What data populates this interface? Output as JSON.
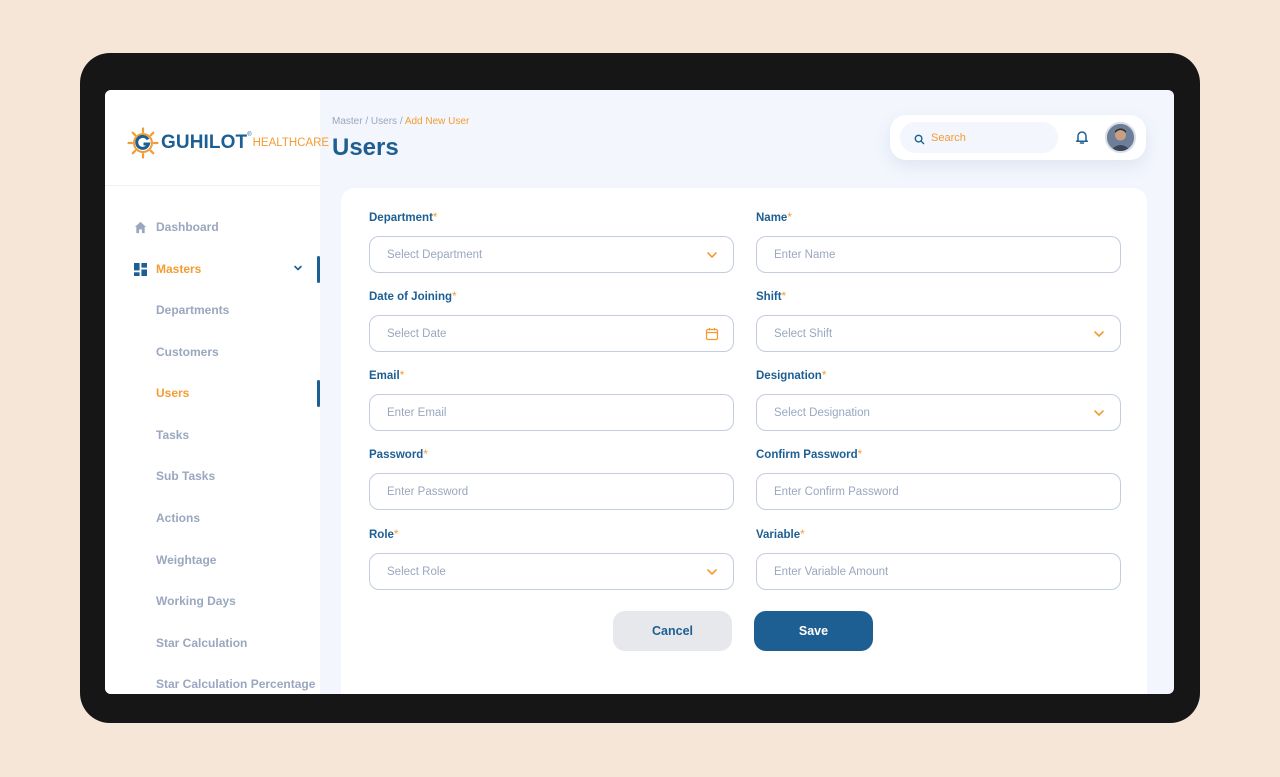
{
  "brand": {
    "name": "GUHILOT",
    "reg": "®",
    "sub": "HEALTHCARE",
    "primary": "#1d5f93",
    "accent": "#f39c33"
  },
  "sidebar": {
    "items": [
      {
        "label": "Dashboard",
        "icon": "home-icon",
        "active": false
      },
      {
        "label": "Masters",
        "icon": "grid-icon",
        "active": true,
        "expanded": true
      },
      {
        "label": "Departments"
      },
      {
        "label": "Customers"
      },
      {
        "label": "Users",
        "active": true
      },
      {
        "label": "Tasks"
      },
      {
        "label": "Sub Tasks"
      },
      {
        "label": "Actions"
      },
      {
        "label": "Weightage"
      },
      {
        "label": "Working Days"
      },
      {
        "label": "Star Calculation"
      },
      {
        "label": "Star Calculation Percentage"
      }
    ]
  },
  "breadcrumb": {
    "part1": "Master",
    "sep": "/",
    "part2": "Users",
    "current": "Add New User"
  },
  "page_title": "Users",
  "search": {
    "placeholder": "Search"
  },
  "form": {
    "department": {
      "label": "Department",
      "placeholder": "Select Department"
    },
    "name": {
      "label": "Name",
      "placeholder": "Enter Name"
    },
    "date_of_joining": {
      "label": "Date of Joining",
      "placeholder": "Select Date"
    },
    "shift": {
      "label": "Shift",
      "placeholder": "Select Shift"
    },
    "email": {
      "label": "Email",
      "placeholder": "Enter Email"
    },
    "designation": {
      "label": "Designation",
      "placeholder": "Select Designation"
    },
    "password": {
      "label": "Password",
      "placeholder": "Enter Password"
    },
    "confirm_password": {
      "label": "Confirm Password",
      "placeholder": "Enter Confirm Password"
    },
    "role": {
      "label": "Role",
      "placeholder": "Select Role"
    },
    "variable": {
      "label": "Variable",
      "placeholder": "Enter Variable Amount"
    },
    "required_mark": "*"
  },
  "buttons": {
    "cancel": "Cancel",
    "save": "Save"
  }
}
